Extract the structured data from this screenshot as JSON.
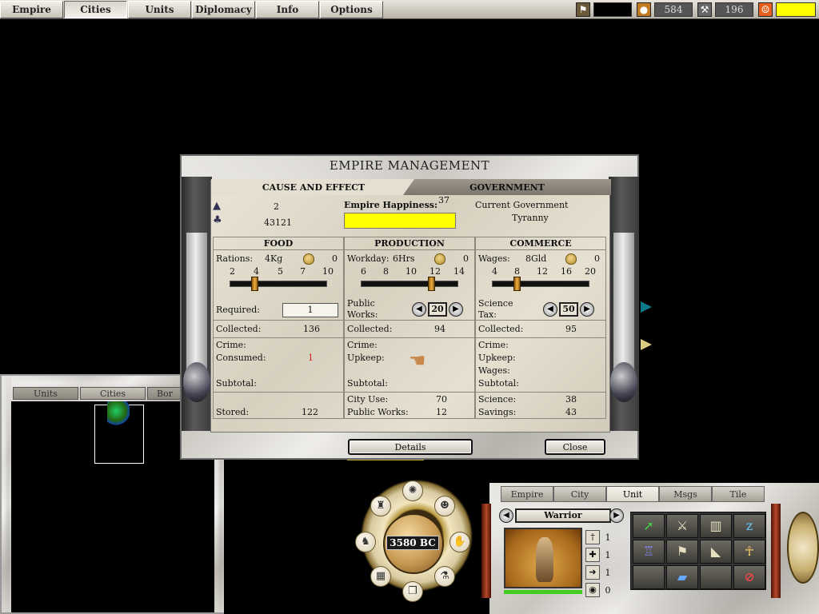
{
  "topbar": {
    "menu": [
      "Empire",
      "Cities",
      "Units",
      "Diplomacy",
      "Info",
      "Options"
    ],
    "active_index": 1,
    "gold": "584",
    "production": "196"
  },
  "dialog": {
    "title": "EMPIRE MANAGEMENT",
    "tabs": [
      "CAUSE AND EFFECT",
      "GOVERNMENT"
    ],
    "summary": {
      "cities": "2",
      "population": "43121",
      "happiness_label": "Empire Happiness:",
      "happiness_value": "37",
      "government_label": "Current Government",
      "government_value": "Tyranny"
    },
    "food": {
      "head": "FOOD",
      "rations_label": "Rations:",
      "rations_value": "4Kg",
      "face_count": "0",
      "scale": [
        "2",
        "4",
        "5",
        "7",
        "10"
      ],
      "slider_level": 1,
      "required_label": "Required:",
      "required_value": "1",
      "collected_label": "Collected:",
      "collected_value": "136",
      "crime_label": "Crime:",
      "consumed_label": "Consumed:",
      "consumed_value": "1",
      "subtotal_label": "Subtotal:",
      "stored_label": "Stored:",
      "stored_value": "122"
    },
    "production": {
      "head": "PRODUCTION",
      "workday_label": "Workday:",
      "workday_value": "6Hrs",
      "face_count": "0",
      "scale": [
        "6",
        "8",
        "10",
        "12",
        "14"
      ],
      "slider_level": 3,
      "public_label": "Public",
      "works_label": "Works:",
      "public_works_value": "20",
      "collected_label": "Collected:",
      "collected_value": "94",
      "crime_label": "Crime:",
      "upkeep_label": "Upkeep:",
      "subtotal_label": "Subtotal:",
      "city_use_label": "City Use:",
      "city_use_value": "70",
      "public_works_label": "Public Works:",
      "public_works_total": "12"
    },
    "commerce": {
      "head": "COMMERCE",
      "wages_label": "Wages:",
      "wages_value": "8Gld",
      "face_count": "0",
      "scale": [
        "4",
        "8",
        "12",
        "16",
        "20"
      ],
      "slider_level": 1,
      "science_label": "Science",
      "tax_label": "Tax:",
      "science_tax_value": "50",
      "collected_label": "Collected:",
      "collected_value": "95",
      "crime_label": "Crime:",
      "upkeep_label": "Upkeep:",
      "wages2_label": "Wages:",
      "subtotal_label": "Subtotal:",
      "science2_label": "Science:",
      "science_value": "38",
      "savings_label": "Savings:",
      "savings_value": "43"
    },
    "details_label": "Details",
    "close_label": "Close"
  },
  "minimap": {
    "tabs": [
      "Units",
      "Cities",
      "Bor"
    ]
  },
  "ring": {
    "date": "3580 BC"
  },
  "unit_panel": {
    "tabs": [
      "Empire",
      "City",
      "Unit",
      "Msgs",
      "Tile"
    ],
    "active_index": 2,
    "unit_name": "Warrior",
    "stats": [
      "1",
      "1",
      "1",
      "0"
    ],
    "hp_fraction": 1.0
  },
  "colors": {
    "happiness_bar": "#ffff00",
    "consumed_value": "#cc2222",
    "topbar_yellow": "#ffff00"
  }
}
